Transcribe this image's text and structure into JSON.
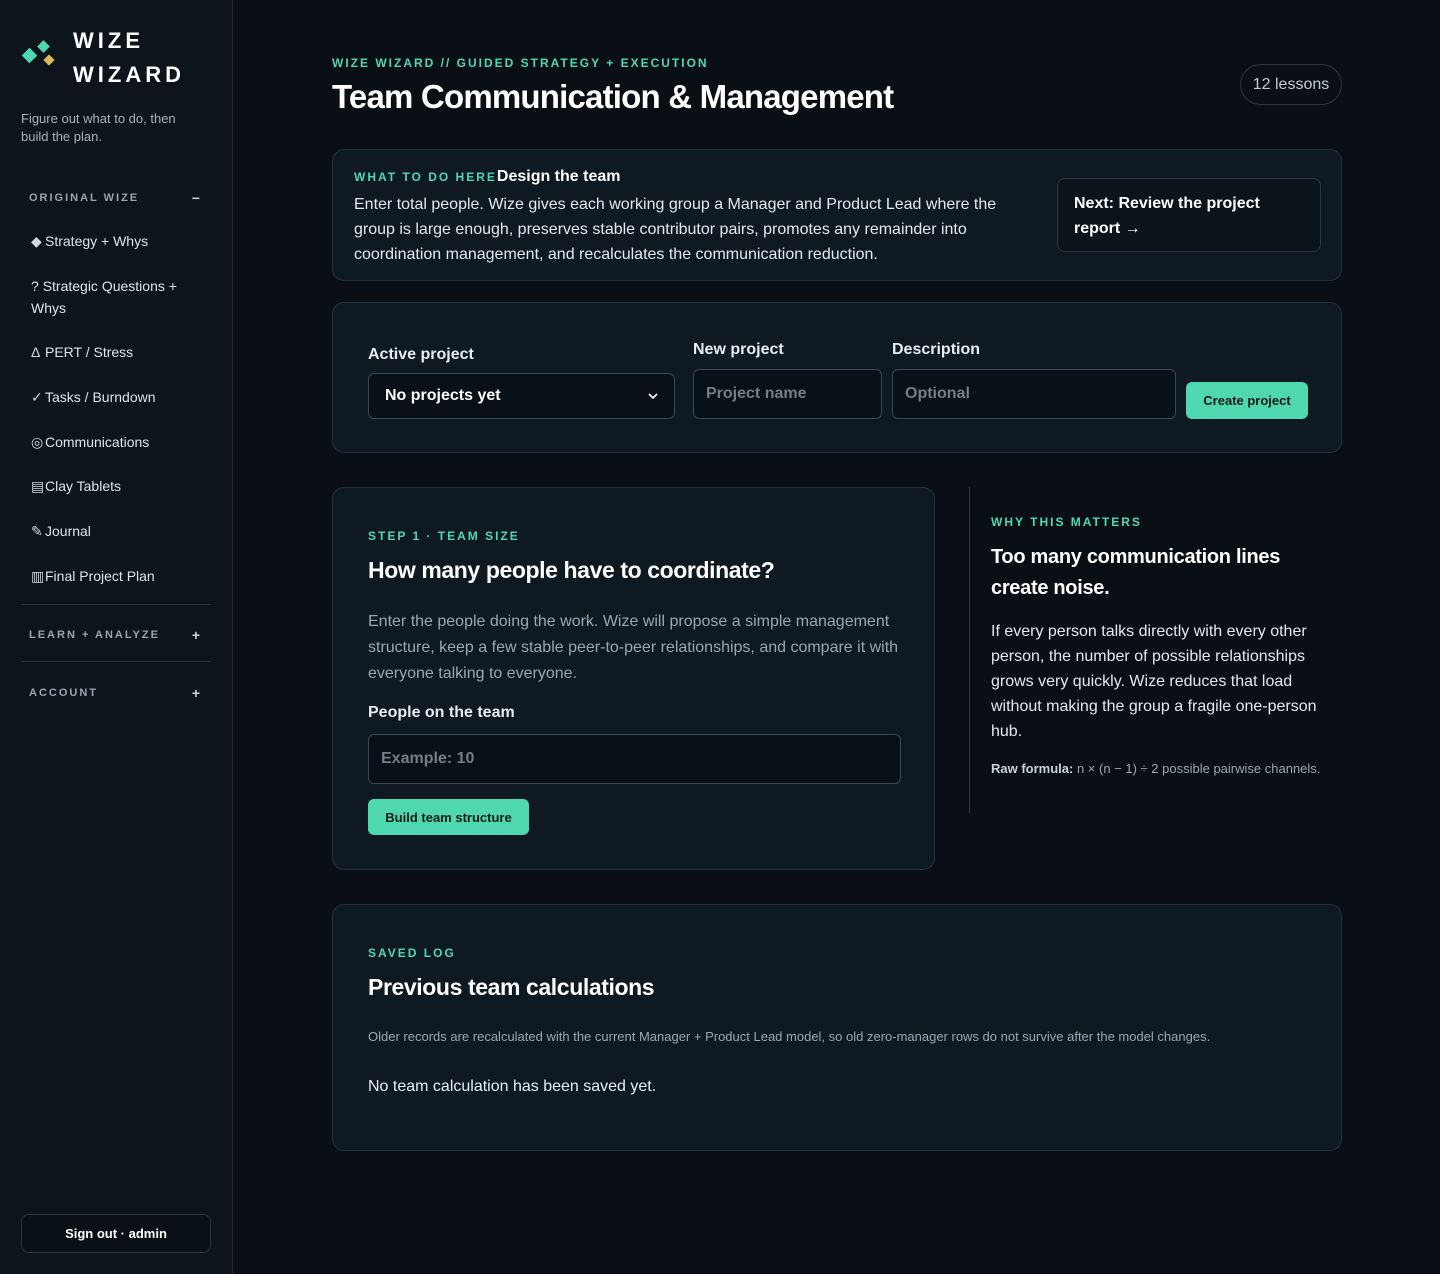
{
  "brand": {
    "name_line1": "WIZE",
    "name_line2": "WIZARD",
    "tagline": "Figure out what to do, then build the plan."
  },
  "sidebar": {
    "sections": [
      {
        "label": "ORIGINAL WIZE",
        "toggle": "−"
      },
      {
        "label": "LEARN + ANALYZE",
        "toggle": "+"
      },
      {
        "label": "ACCOUNT",
        "toggle": "+"
      }
    ],
    "items": [
      {
        "icon": "◆",
        "label": "Strategy + Whys"
      },
      {
        "icon": "?",
        "label": "Strategic Questions + Whys"
      },
      {
        "icon": "Δ",
        "label": "PERT / Stress"
      },
      {
        "icon": "✓",
        "label": "Tasks / Burndown"
      },
      {
        "icon": "◎",
        "label": "Communications"
      },
      {
        "icon": "▤",
        "label": "Clay Tablets"
      },
      {
        "icon": "✎",
        "label": "Journal"
      },
      {
        "icon": "▥",
        "label": "Final Project Plan"
      }
    ],
    "signout": "Sign out · admin"
  },
  "header": {
    "eyebrow": "WIZE WIZARD // GUIDED STRATEGY + EXECUTION",
    "title": "Team Communication & Management",
    "lessons": "12 lessons"
  },
  "todo": {
    "eyebrow": "WHAT TO DO HERE",
    "title": "Design the team",
    "text": "Enter total people. Wize gives each working group a Manager and Product Lead where the group is large enough, preserves stable contributor pairs, promotes any remainder into coordination management, and recalculates the communication reduction.",
    "next_label": "Next: Review the project report →"
  },
  "project": {
    "active_label": "Active project",
    "active_value": "No projects yet",
    "new_label": "New project",
    "new_placeholder": "Project name",
    "desc_label": "Description",
    "desc_placeholder": "Optional",
    "create_label": "Create project"
  },
  "step": {
    "eyebrow": "STEP 1 · TEAM SIZE",
    "title": "How many people have to coordinate?",
    "description": "Enter the people doing the work. Wize will propose a simple management structure, keep a few stable peer-to-peer relationships, and compare it with everyone talking to everyone.",
    "field_label": "People on the team",
    "field_placeholder": "Example: 10",
    "button_label": "Build team structure"
  },
  "why": {
    "eyebrow": "WHY THIS MATTERS",
    "title": "Too many communication lines create noise.",
    "text": "If every person talks directly with every other person, the number of possible relationships grows very quickly. Wize reduces that load without making the group a fragile one-person hub.",
    "formula_label": "Raw formula:",
    "formula": "n × (n − 1) ÷ 2 possible pairwise channels."
  },
  "log": {
    "eyebrow": "SAVED LOG",
    "title": "Previous team calculations",
    "note": "Older records are recalculated with the current Manager + Product Lead model, so old zero-manager rows do not survive after the model changes.",
    "empty": "No team calculation has been saved yet."
  },
  "colors": {
    "accent": "#4fd8b0",
    "gold": "#d9b85a",
    "background": "#0a0f15",
    "card": "#0f1922"
  }
}
